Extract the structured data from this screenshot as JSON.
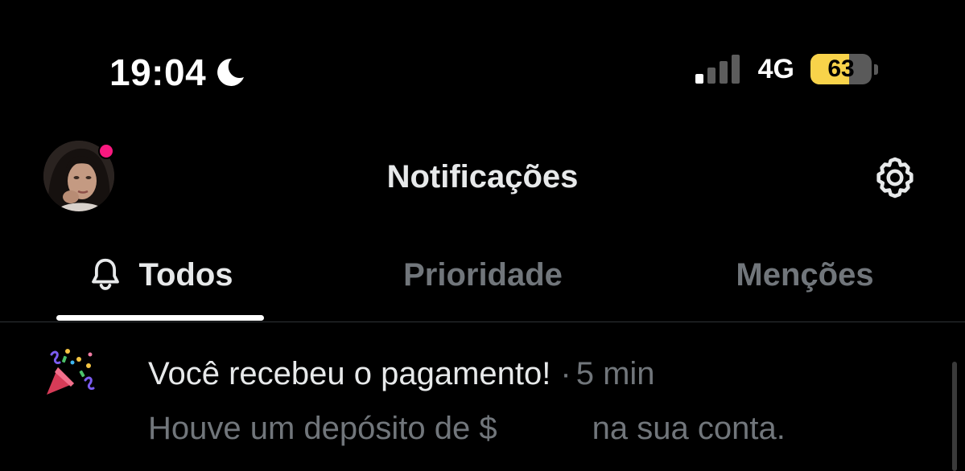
{
  "status_bar": {
    "time": "19:04",
    "network": "4G",
    "battery_level": "63",
    "battery_percent": 63,
    "moon_icon": "moon-icon",
    "signal_icon": "cellular-signal-icon",
    "battery_color": "#f8d34a"
  },
  "header": {
    "title": "Notificações",
    "avatar": "avatar",
    "has_unread_dot": true,
    "unread_dot_color": "#f9197f",
    "settings_icon": "gear-icon"
  },
  "tabs": [
    {
      "label": "Todos",
      "active": true,
      "icon": "bell-icon"
    },
    {
      "label": "Prioridade",
      "active": false
    },
    {
      "label": "Menções",
      "active": false
    }
  ],
  "notifications": [
    {
      "icon": "party-popper-icon",
      "title": "Você recebeu o pagamento!",
      "separator": "·",
      "time": "5 min",
      "body_start": "Houve um depósito de $",
      "body_end": "na sua conta."
    }
  ],
  "colors": {
    "background": "#000000",
    "text_primary": "#e7e9ea",
    "text_secondary": "#71767b"
  }
}
